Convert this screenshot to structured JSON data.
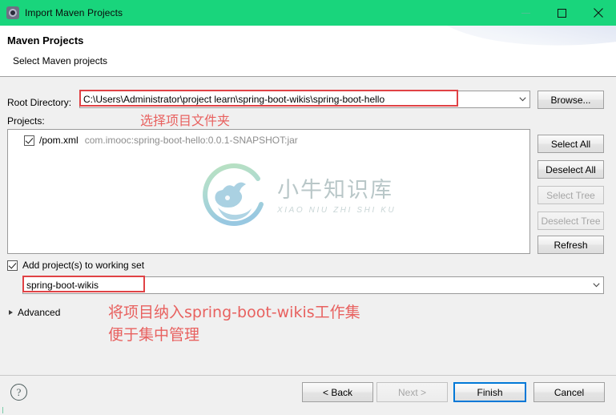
{
  "window": {
    "title": "Import Maven Projects",
    "icon": "maven-gear-icon",
    "titlebar_color": "#19d57c",
    "controls": {
      "minimize": "minimize-icon",
      "maximize": "maximize-icon",
      "close": "close-icon"
    }
  },
  "header": {
    "title": "Maven Projects",
    "subtitle": "Select Maven projects"
  },
  "form": {
    "root_directory_label": "Root Directory:",
    "root_directory_value": "C:\\Users\\Administrator\\project learn\\spring-boot-wikis\\spring-boot-hello",
    "root_directory_placeholder": "C:\\...",
    "browse_label": "Browse...",
    "projects_label": "Projects:",
    "tree": [
      {
        "checked": true,
        "name": "/pom.xml",
        "coordinates": "com.imooc:spring-boot-hello:0.0.1-SNAPSHOT:jar"
      }
    ],
    "side_buttons": [
      {
        "label": "Select All",
        "enabled": true
      },
      {
        "label": "Deselect All",
        "enabled": true
      },
      {
        "label": "Select Tree",
        "enabled": false
      },
      {
        "label": "Deselect Tree",
        "enabled": false
      },
      {
        "label": "Refresh",
        "enabled": true
      }
    ],
    "working_set": {
      "checkbox_label": "Add project(s) to working set",
      "checked": true,
      "value": "spring-boot-wikis"
    },
    "advanced_label": "Advanced"
  },
  "annotations": {
    "color": "#e8615f",
    "box_color": "#e04245",
    "note_root_directory": "选择项目文件夹",
    "note_working_set_line1": "将项目纳入spring-boot-wikis工作集",
    "note_working_set_line2": "便于集中管理"
  },
  "watermark": {
    "cn": "小牛知识库",
    "en": "XIAO NIU ZHI SHI KU"
  },
  "footer": {
    "help": "?",
    "back_label": "< Back",
    "next_label": "Next >",
    "next_enabled": false,
    "finish_label": "Finish",
    "finish_default": true,
    "cancel_label": "Cancel"
  }
}
